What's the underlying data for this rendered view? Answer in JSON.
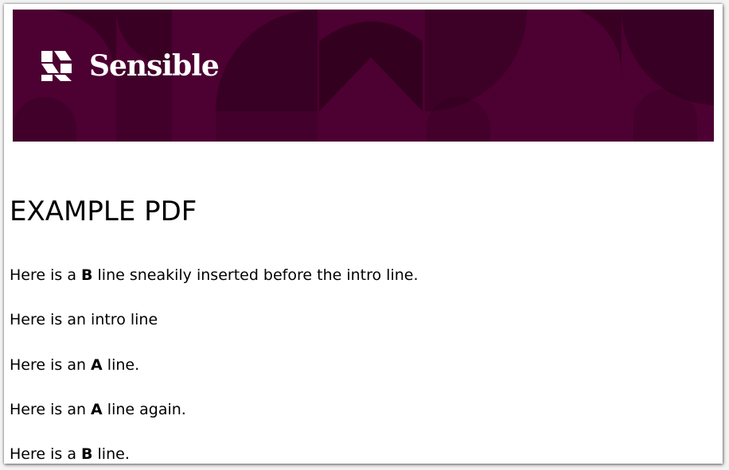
{
  "banner": {
    "brand_name": "Sensible",
    "logo_icon": "sensible-logo-icon",
    "background_color": "#4d0032",
    "pattern_color": "#2a001a",
    "text_color": "#ffffff"
  },
  "document": {
    "title": "EXAMPLE PDF",
    "lines": [
      {
        "pre": "Here is a ",
        "bold": "B",
        "post": " line sneakily inserted before the intro line."
      },
      {
        "pre": "Here is an intro line",
        "bold": "",
        "post": ""
      },
      {
        "pre": "Here is an ",
        "bold": "A",
        "post": " line."
      },
      {
        "pre": "Here is an ",
        "bold": "A",
        "post": " line again."
      },
      {
        "pre": "Here is a ",
        "bold": "B",
        "post": " line."
      }
    ]
  }
}
